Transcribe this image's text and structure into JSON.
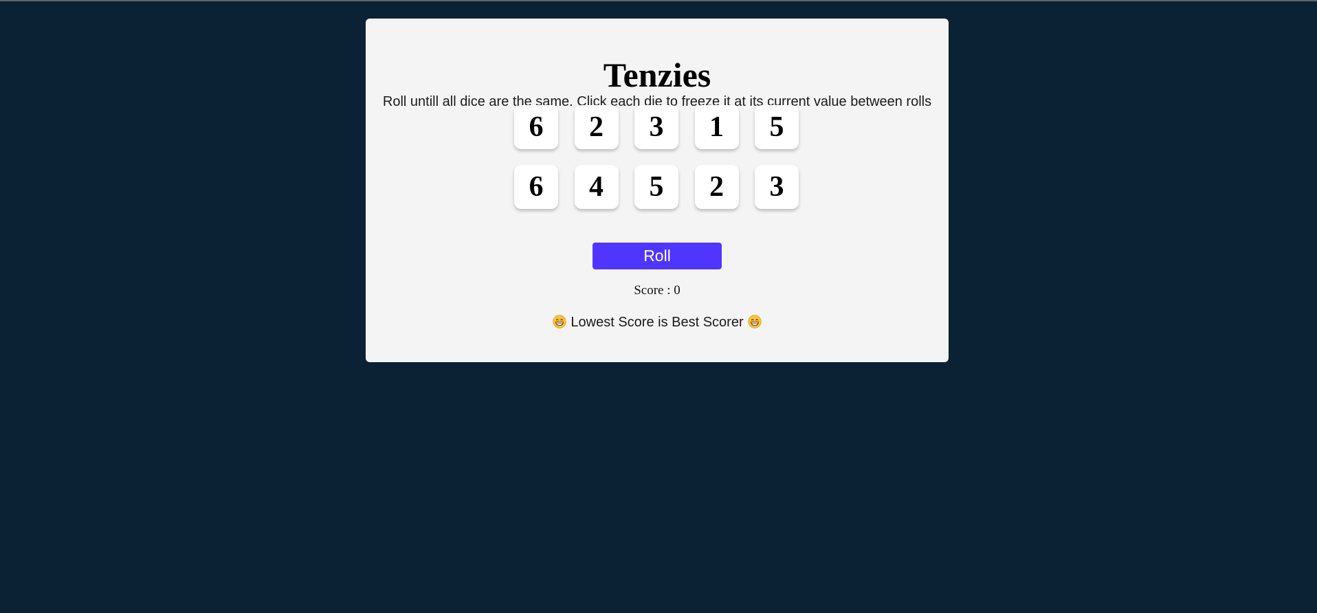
{
  "game": {
    "title": "Tenzies",
    "instructions": "Roll untill all dice are the same. Click each die to freeze it at its current value between rolls",
    "dice": [
      "6",
      "2",
      "3",
      "1",
      "5",
      "6",
      "4",
      "5",
      "2",
      "3"
    ],
    "roll_label": "Roll",
    "score_text": "Score : 0",
    "tagline": "Lowest Score is Best Scorer",
    "tagline_icon": "grinning-face-icon"
  },
  "colors": {
    "page_background": "#0b2234",
    "card_background": "#f4f4f4",
    "roll_button": "#5035ff",
    "die_background": "#ffffff"
  }
}
